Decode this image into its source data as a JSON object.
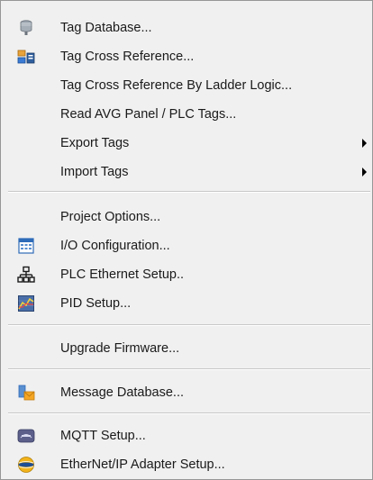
{
  "menu": {
    "items": [
      {
        "label": "Tag Database...",
        "icon": "tag-database-icon"
      },
      {
        "label": "Tag Cross Reference...",
        "icon": "tag-cross-reference-icon"
      },
      {
        "label": "Tag Cross Reference By Ladder Logic...",
        "icon": ""
      },
      {
        "label": "Read AVG Panel / PLC Tags...",
        "icon": ""
      },
      {
        "label": "Export Tags",
        "icon": "",
        "submenu": true
      },
      {
        "label": "Import Tags",
        "icon": "",
        "submenu": true
      },
      {
        "label": "Project Options...",
        "icon": ""
      },
      {
        "label": "I/O Configuration...",
        "icon": "io-configuration-icon"
      },
      {
        "label": "PLC Ethernet Setup..",
        "icon": "network-icon"
      },
      {
        "label": "PID Setup...",
        "icon": "pid-chart-icon"
      },
      {
        "label": "Upgrade Firmware...",
        "icon": ""
      },
      {
        "label": "Message Database...",
        "icon": "message-database-icon"
      },
      {
        "label": "MQTT Setup...",
        "icon": "mqtt-icon"
      },
      {
        "label": "EtherNet/IP Adapter Setup...",
        "icon": "ethernet-ip-icon"
      }
    ]
  }
}
